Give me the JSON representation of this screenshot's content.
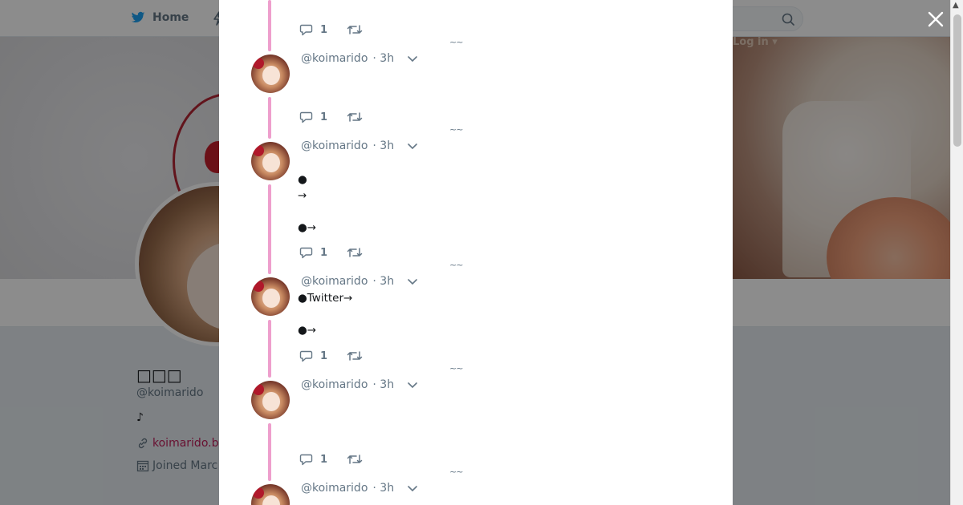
{
  "topbar": {
    "home_label": "Home",
    "login_label": "Log in ▾"
  },
  "profile": {
    "name": "□□□",
    "handle": "@koimarido",
    "bio": "♪",
    "url": "koimarido.b",
    "joined": "Joined Marc"
  },
  "colors": {
    "thread_line": "#ee9fcd",
    "link": "#bd1e59",
    "muted": "#657786"
  },
  "tweets": [
    {
      "handle": "@koimarido",
      "time": "· 3h",
      "text": "",
      "replies": "1"
    },
    {
      "handle": "@koimarido",
      "time": "· 3h",
      "text": "●\n→\n\n●→",
      "replies": "1"
    },
    {
      "handle": "@koimarido",
      "time": "· 3h",
      "text": "●Twitter→\n\n●→",
      "replies": "1"
    },
    {
      "handle": "@koimarido",
      "time": "· 3h",
      "text": "",
      "replies": "1"
    },
    {
      "handle": "@koimarido",
      "time": "· 3h",
      "text": "",
      "replies": ""
    }
  ],
  "top_actions": {
    "replies": "1"
  },
  "tilde_glyph": "~~"
}
